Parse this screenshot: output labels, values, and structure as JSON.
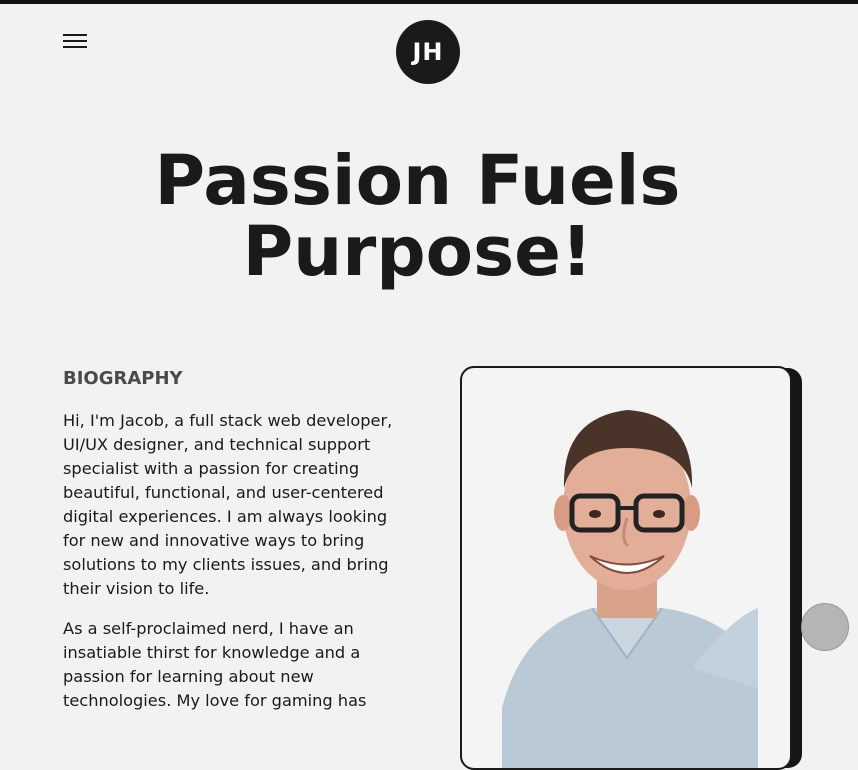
{
  "header": {
    "logo_text": "JH",
    "menu_icon": "hamburger-icon"
  },
  "hero": {
    "title_line1": "Passion Fuels",
    "title_line2": "Purpose!"
  },
  "biography": {
    "heading": "BIOGRAPHY",
    "paragraph1": "Hi, I'm Jacob, a full stack web developer, UI/UX designer, and technical support specialist with a passion for creating beautiful, functional, and user-centered digital experiences. I am always looking for new and innovative ways to bring solutions to my clients issues, and bring their vision to life.",
    "paragraph2": "As a self-proclaimed nerd, I have an insatiable thirst for knowledge and a passion for learning about new technologies. My love for gaming has"
  },
  "floating": {
    "icon": "scroll-top-icon"
  }
}
